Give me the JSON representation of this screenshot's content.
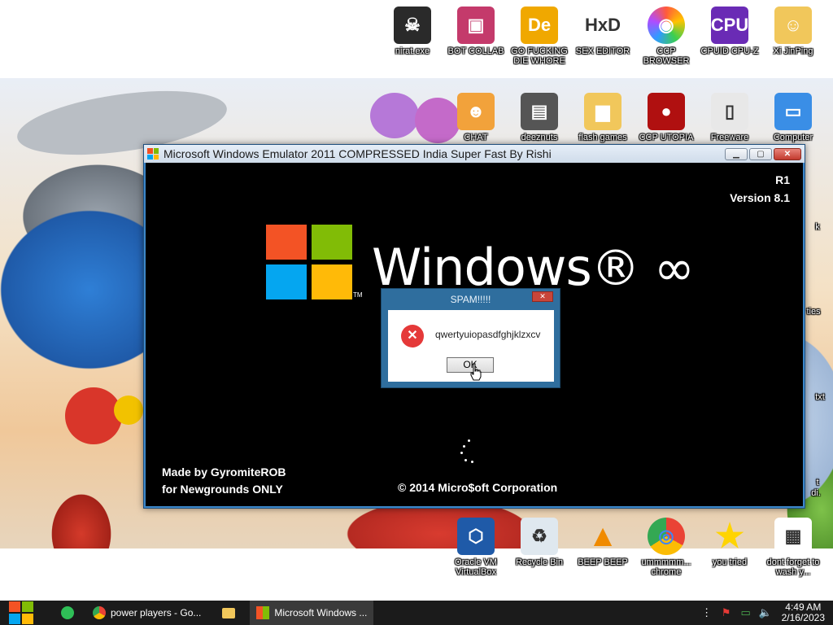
{
  "desktop": {
    "top_icons": [
      {
        "label": "nirat.exe",
        "icon": "skull-icon",
        "color": "#2a2a2a"
      },
      {
        "label": "BOT COLLAB",
        "icon": "monitor-icon",
        "color": "#c43a6b"
      },
      {
        "label": "GO FUCKING DIE WHORE",
        "icon": "de-icon",
        "color": "#f0a800"
      },
      {
        "label": "SEX EDITOR",
        "icon": "hxd-icon",
        "color": "#ffffff"
      },
      {
        "label": "CCP BROWSER",
        "icon": "browser-icon",
        "color": "#ff5a3c"
      },
      {
        "label": "CPUID CPU-Z",
        "icon": "cpuz-icon",
        "color": "#6a2bb5"
      },
      {
        "label": "Xi JinPing",
        "icon": "folder-user-icon",
        "color": "#f1c75b"
      }
    ],
    "second_row_icons": [
      {
        "label": "CHAT",
        "icon": "chat-icon",
        "color": "#f2a23b"
      },
      {
        "label": "deeznuts",
        "icon": "stack-icon",
        "color": "#555555"
      },
      {
        "label": "flash games",
        "icon": "folder-icon",
        "color": "#f1c75b"
      },
      {
        "label": "CCP UTOPIA",
        "icon": "utopia-icon",
        "color": "#b01010"
      },
      {
        "label": "Freeware",
        "icon": "doc-icon",
        "color": "#e8e8e8"
      },
      {
        "label": "Computer",
        "icon": "computer-icon",
        "color": "#3a8ee6"
      }
    ],
    "side_labels": [
      "k",
      "ties",
      "txt",
      "t",
      "di."
    ],
    "bottom_icons": [
      {
        "label": "Oracle VM VirtualBox",
        "icon": "virtualbox-icon",
        "color": "#1f5aa8"
      },
      {
        "label": "Recycle Bin",
        "icon": "recycle-bin-icon",
        "color": "#dfe8ef"
      },
      {
        "label": "BEEP BEEP",
        "icon": "vlc-icon",
        "color": "#f08a00"
      },
      {
        "label": "ummmmm... chrome",
        "icon": "chrome-icon",
        "color": "#ea4335"
      },
      {
        "label": "you tried",
        "icon": "star-icon",
        "color": "#ffd400"
      },
      {
        "label": "dont forget to wash y...",
        "icon": "calendar-doc-icon",
        "color": "#ffffff"
      }
    ]
  },
  "main_window": {
    "title": "Microsoft Windows Emulator 2011 COMPRESSED India Super Fast By Rishi",
    "minimize": "▁",
    "maximize": "▢",
    "close": "✕",
    "release": "R1",
    "version": "Version 8.1",
    "brand": "Windows",
    "brand_suffix": "® ∞",
    "trademark": "TM",
    "credits_line1": "Made by GyromiteROB",
    "credits_line2": "for Newgrounds ONLY",
    "copyright": "© 2014 Micro$oft Corporation"
  },
  "dialog": {
    "title": "SPAM!!!!!",
    "close": "✕",
    "message": "qwertyuiopasdfghjklzxcv",
    "ok_label": "OK"
  },
  "taskbar": {
    "tasks": [
      {
        "label": "power players - Go...",
        "icon": "chrome-icon"
      },
      {
        "label": "",
        "icon": "file-explorer-icon"
      },
      {
        "label": "Microsoft Windows ...",
        "icon": "windows-emulator-icon"
      }
    ],
    "time": "4:49 AM",
    "date": "2/16/2023"
  }
}
